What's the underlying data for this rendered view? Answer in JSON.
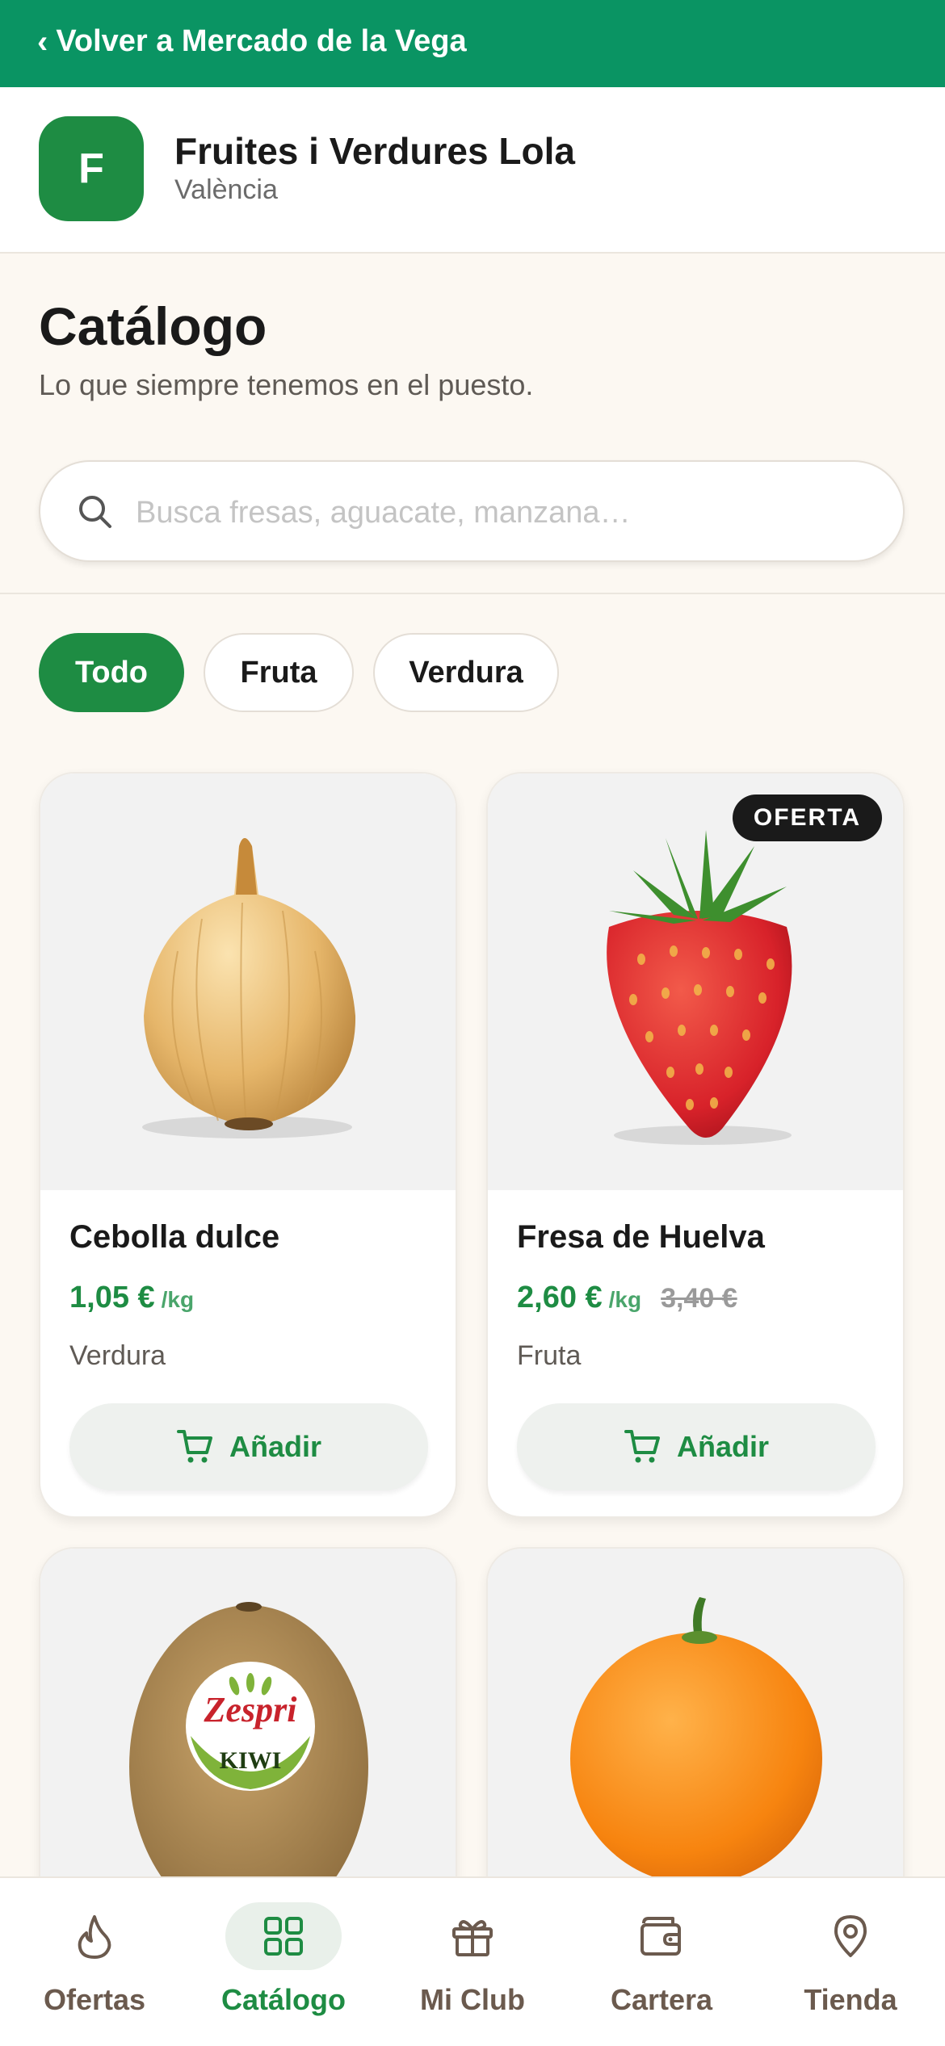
{
  "topbar": {
    "back_label": "Volver a Mercado de la Vega"
  },
  "store": {
    "initial": "F",
    "name": "Fruites i Verdures Lola",
    "city": "València"
  },
  "catalog": {
    "title": "Catálogo",
    "subtitle": "Lo que siempre tenemos en el puesto."
  },
  "search": {
    "placeholder": "Busca fresas, aguacate, manzana…",
    "value": ""
  },
  "filters": [
    {
      "label": "Todo",
      "active": true
    },
    {
      "label": "Fruta",
      "active": false
    },
    {
      "label": "Verdura",
      "active": false
    }
  ],
  "products": [
    {
      "name": "Cebolla dulce",
      "price": "1,05 €",
      "unit": "/kg",
      "old_price": "",
      "category": "Verdura",
      "add_label": "Añadir",
      "badge": "",
      "image": "onion-image"
    },
    {
      "name": "Fresa de Huelva",
      "price": "2,60 €",
      "unit": "/kg",
      "old_price": "3,40 €",
      "category": "Fruta",
      "add_label": "Añadir",
      "badge": "OFERTA",
      "image": "strawberry-image"
    },
    {
      "image": "kiwi-image",
      "kiwi_sticker_brand": "Zespri",
      "kiwi_sticker_text": "KIWI"
    },
    {
      "image": "orange-image"
    }
  ],
  "bottom_nav": [
    {
      "label": "Ofertas",
      "icon": "flame-icon",
      "active": false
    },
    {
      "label": "Catálogo",
      "icon": "grid-icon",
      "active": true
    },
    {
      "label": "Mi Club",
      "icon": "gift-icon",
      "active": false
    },
    {
      "label": "Cartera",
      "icon": "wallet-icon",
      "active": false
    },
    {
      "label": "Tienda",
      "icon": "location-pin-icon",
      "active": false
    }
  ],
  "colors": {
    "brand_green": "#0a9463",
    "accent_green": "#1e8c43",
    "background": "#fcf8f2",
    "badge": "#1a1a1a"
  }
}
